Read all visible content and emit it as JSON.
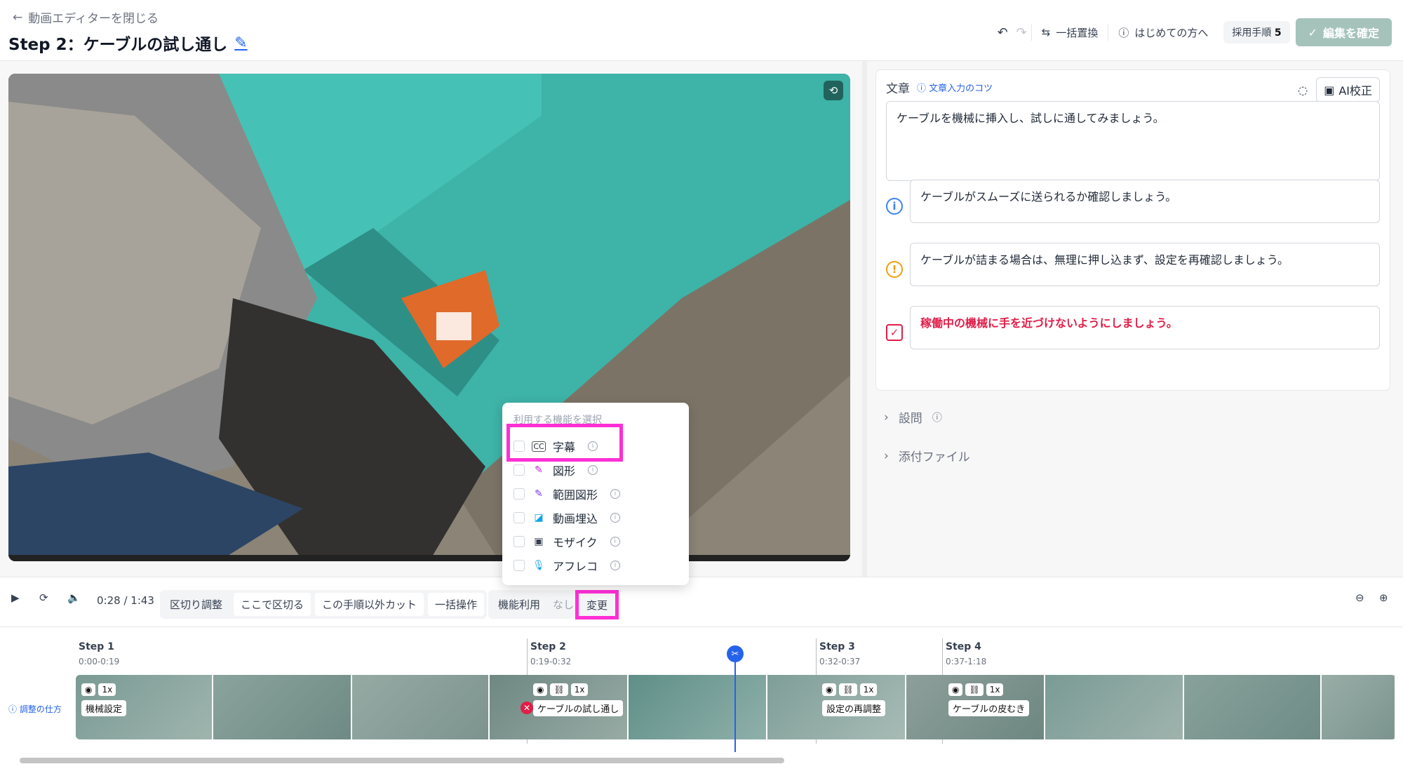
{
  "header": {
    "back_label": "動画エディターを閉じる",
    "title": "Step 2：ケーブルの試し通し",
    "tools": {
      "bulk_replace": "一括置換",
      "beginners": "はじめての方へ",
      "adopted_label": "採用手順",
      "adopted_count": "5",
      "confirm": "編集を確定"
    }
  },
  "editor": {
    "text_label": "文章",
    "tips_link": "文章入力のコツ",
    "ai_button": "AI校正",
    "main_text": "ケーブルを機械に挿入し、試しに通してみましょう。",
    "notes": [
      {
        "type": "info",
        "text": "ケーブルがスムーズに送られるか確認しましょう。",
        "color": "#3b82f6"
      },
      {
        "type": "warning",
        "text": "ケーブルが詰まる場合は、無理に押し込まず、設定を再確認しましょう。",
        "color": "#f59e0b"
      },
      {
        "type": "danger",
        "text": "稼働中の機械に手を近づけないようにしましょう。",
        "color": "#e11d48"
      }
    ],
    "question_label": "設問",
    "attachment_label": "添付ファイル"
  },
  "popup": {
    "title": "利用する機能を選択",
    "items": [
      {
        "label": "字幕",
        "icon": "cc-icon"
      },
      {
        "label": "図形",
        "icon": "pen-icon"
      },
      {
        "label": "範囲図形",
        "icon": "pen-area-icon"
      },
      {
        "label": "動画埋込",
        "icon": "embed-icon"
      },
      {
        "label": "モザイク",
        "icon": "mosaic-icon"
      },
      {
        "label": "アフレコ",
        "icon": "mic-icon"
      }
    ]
  },
  "controls": {
    "time": "0:28 / 1:43",
    "split_adjust": "区切り調整",
    "split_here": "ここで区切る",
    "cut_others": "この手順以外カット",
    "bulk_ops": "一括操作",
    "feature_label": "機能利用",
    "feature_value": "なし",
    "change": "変更"
  },
  "timeline": {
    "howto": "調整の仕方",
    "steps": [
      {
        "label": "Step 1",
        "range": "0:00-0:19",
        "name": "機械設定",
        "speed": "1x"
      },
      {
        "label": "Step 2",
        "range": "0:19-0:32",
        "name": "ケーブルの試し通し",
        "speed": "1x"
      },
      {
        "label": "Step 3",
        "range": "0:32-0:37",
        "name": "設定の再調整",
        "speed": "1x"
      },
      {
        "label": "Step 4",
        "range": "0:37-1:18",
        "name": "ケーブルの皮むき",
        "speed": "1x"
      }
    ]
  },
  "colors": {
    "highlight": "#ff2fd6",
    "accent": "#2563eb",
    "confirm_button": "#a5c3bb"
  }
}
